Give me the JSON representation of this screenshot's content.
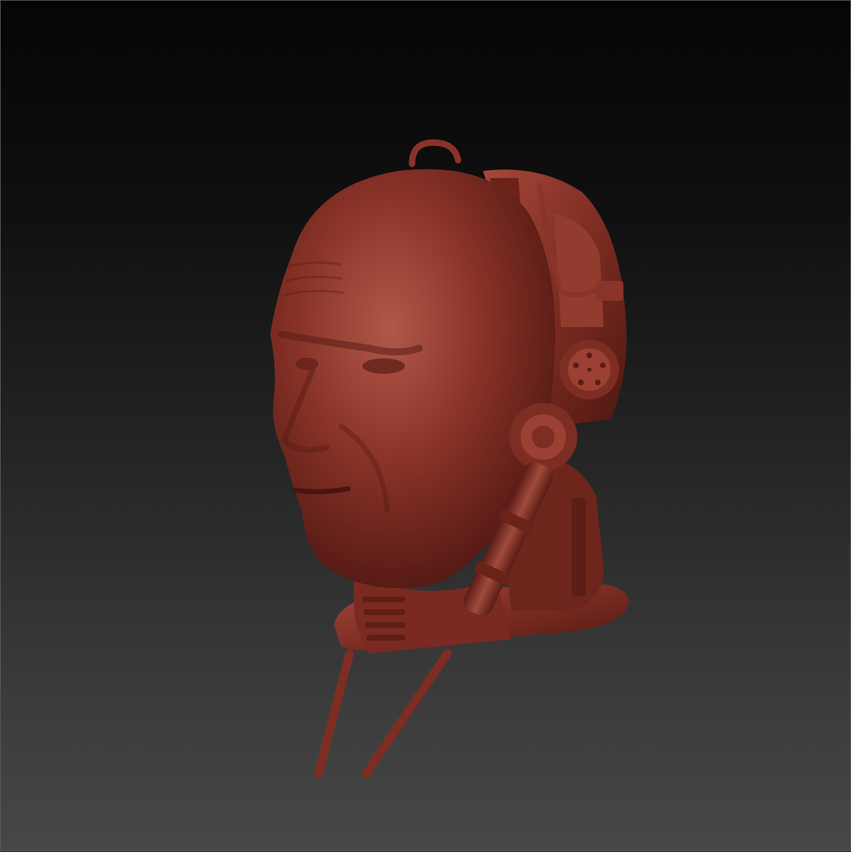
{
  "viewport": {
    "background_top": "#050505",
    "background_bottom": "#474747"
  },
  "model": {
    "subject": "cyborg-head-sculpt",
    "material_color": "#8a3328",
    "material_highlight": "#b0594a",
    "material_shadow": "#4a1510"
  }
}
